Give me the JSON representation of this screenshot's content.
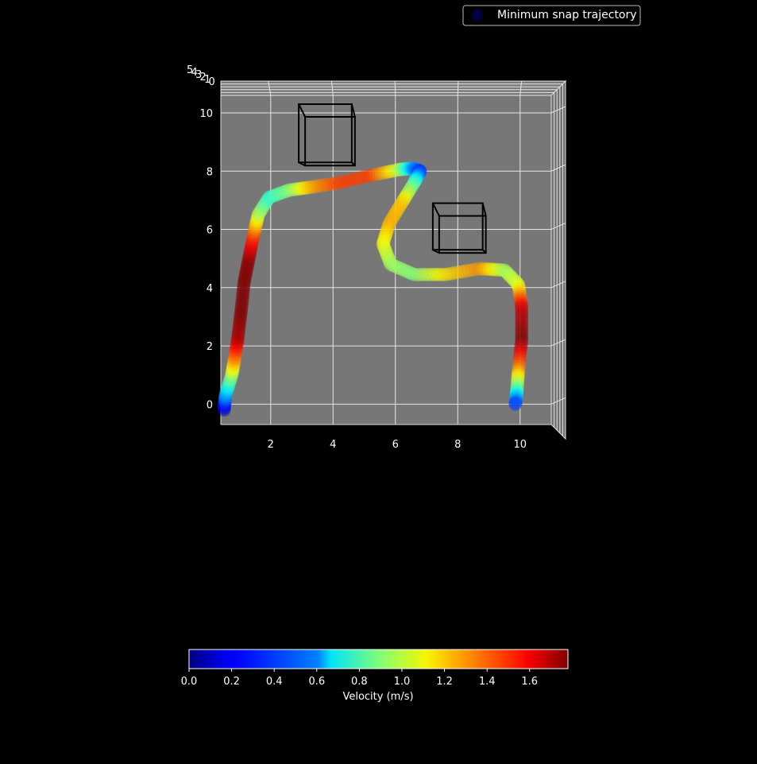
{
  "chart_data": {
    "type": "scatter",
    "projection": "3d-top-view",
    "title": "",
    "xlabel": "",
    "ylabel": "",
    "xlim": [
      0.4,
      11.0
    ],
    "ylim": [
      -0.7,
      10.6
    ],
    "zlim": [
      0,
      5
    ],
    "x_ticks": [
      "2",
      "4",
      "6",
      "8",
      "10"
    ],
    "x_tick_values": [
      2,
      4,
      6,
      8,
      10
    ],
    "y_ticks": [
      "0",
      "2",
      "4",
      "6",
      "8",
      "10"
    ],
    "y_tick_values": [
      0,
      2,
      4,
      6,
      8,
      10
    ],
    "z_ticks": [
      "5",
      "4",
      "3",
      "2",
      "1",
      "0"
    ],
    "grid": true,
    "pane_color": "#777777",
    "legend": {
      "placement": "top-right",
      "entries": [
        "Minimum snap trajectory"
      ]
    },
    "series": [
      {
        "name": "Minimum snap trajectory",
        "waypoints": [
          {
            "x": 0.5,
            "y": -0.2,
            "v": 0.1
          },
          {
            "x": 0.55,
            "y": 0.3,
            "v": 0.5
          },
          {
            "x": 0.75,
            "y": 1.0,
            "v": 0.95
          },
          {
            "x": 0.85,
            "y": 1.6,
            "v": 1.35
          },
          {
            "x": 0.95,
            "y": 2.3,
            "v": 1.7
          },
          {
            "x": 1.05,
            "y": 3.2,
            "v": 1.78
          },
          {
            "x": 1.15,
            "y": 4.2,
            "v": 1.78
          },
          {
            "x": 1.3,
            "y": 5.0,
            "v": 1.75
          },
          {
            "x": 1.45,
            "y": 5.8,
            "v": 1.45
          },
          {
            "x": 1.6,
            "y": 6.5,
            "v": 1.0
          },
          {
            "x": 1.95,
            "y": 7.1,
            "v": 0.75
          },
          {
            "x": 2.6,
            "y": 7.35,
            "v": 0.9
          },
          {
            "x": 3.3,
            "y": 7.45,
            "v": 1.25
          },
          {
            "x": 4.2,
            "y": 7.6,
            "v": 1.45
          },
          {
            "x": 5.2,
            "y": 7.85,
            "v": 1.45
          },
          {
            "x": 6.1,
            "y": 8.05,
            "v": 1.0
          },
          {
            "x": 6.55,
            "y": 8.1,
            "v": 0.5
          },
          {
            "x": 6.8,
            "y": 8.0,
            "v": 0.3
          },
          {
            "x": 6.6,
            "y": 7.6,
            "v": 0.8
          },
          {
            "x": 6.2,
            "y": 6.9,
            "v": 1.2
          },
          {
            "x": 5.8,
            "y": 6.2,
            "v": 1.25
          },
          {
            "x": 5.6,
            "y": 5.5,
            "v": 1.1
          },
          {
            "x": 5.85,
            "y": 4.8,
            "v": 0.95
          },
          {
            "x": 6.6,
            "y": 4.45,
            "v": 0.9
          },
          {
            "x": 7.6,
            "y": 4.45,
            "v": 1.15
          },
          {
            "x": 8.7,
            "y": 4.65,
            "v": 1.3
          },
          {
            "x": 9.5,
            "y": 4.6,
            "v": 0.95
          },
          {
            "x": 9.95,
            "y": 4.1,
            "v": 1.05
          },
          {
            "x": 10.05,
            "y": 3.3,
            "v": 1.65
          },
          {
            "x": 10.05,
            "y": 2.2,
            "v": 1.78
          },
          {
            "x": 9.95,
            "y": 1.2,
            "v": 1.3
          },
          {
            "x": 9.9,
            "y": 0.5,
            "v": 0.8
          },
          {
            "x": 9.85,
            "y": 0.0,
            "v": 0.3
          }
        ]
      }
    ],
    "obstacles": [
      {
        "x": [
          2.9,
          4.6
        ],
        "y": [
          8.3,
          10.3
        ]
      },
      {
        "x": [
          7.2,
          8.8
        ],
        "y": [
          5.3,
          6.9
        ]
      }
    ],
    "colorbar": {
      "label": "Velocity (m/s)",
      "min": 0.0,
      "max": 1.78,
      "ticks": [
        "0.0",
        "0.2",
        "0.4",
        "0.6",
        "0.8",
        "1.0",
        "1.2",
        "1.4",
        "1.6"
      ],
      "tick_values": [
        0.0,
        0.2,
        0.4,
        0.6,
        0.8,
        1.0,
        1.2,
        1.4,
        1.6
      ],
      "colormap": "jet"
    }
  }
}
